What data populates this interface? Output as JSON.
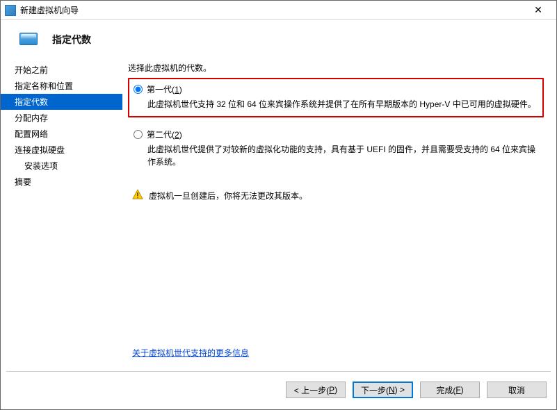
{
  "window": {
    "title": "新建虚拟机向导",
    "close_glyph": "✕"
  },
  "header": {
    "title": "指定代数"
  },
  "sidebar": {
    "items": [
      {
        "label": "开始之前"
      },
      {
        "label": "指定名称和位置"
      },
      {
        "label": "指定代数"
      },
      {
        "label": "分配内存"
      },
      {
        "label": "配置网络"
      },
      {
        "label": "连接虚拟硬盘"
      },
      {
        "label": "安装选项"
      },
      {
        "label": "摘要"
      }
    ],
    "selected_index": 2,
    "indent_index": 6
  },
  "main": {
    "prompt": "选择此虚拟机的代数。",
    "gen1": {
      "label_prefix": "第一代(",
      "label_accel": "1",
      "label_suffix": ")",
      "desc": "此虚拟机世代支持 32 位和 64 位来宾操作系统并提供了在所有早期版本的 Hyper-V 中已可用的虚拟硬件。"
    },
    "gen2": {
      "label_prefix": "第二代(",
      "label_accel": "2",
      "label_suffix": ")",
      "desc": "此虚拟机世代提供了对较新的虚拟化功能的支持，具有基于 UEFI 的固件，并且需要受支持的 64 位来宾操作系统。"
    },
    "selected_generation": "gen1",
    "warning": "虚拟机一旦创建后，你将无法更改其版本。",
    "link_text": "关于虚拟机世代支持的更多信息"
  },
  "footer": {
    "back_prefix": "< 上一步(",
    "back_accel": "P",
    "back_suffix": ")",
    "next_prefix": "下一步(",
    "next_accel": "N",
    "next_suffix": ") >",
    "finish_prefix": "完成(",
    "finish_accel": "F",
    "finish_suffix": ")",
    "cancel": "取消"
  }
}
